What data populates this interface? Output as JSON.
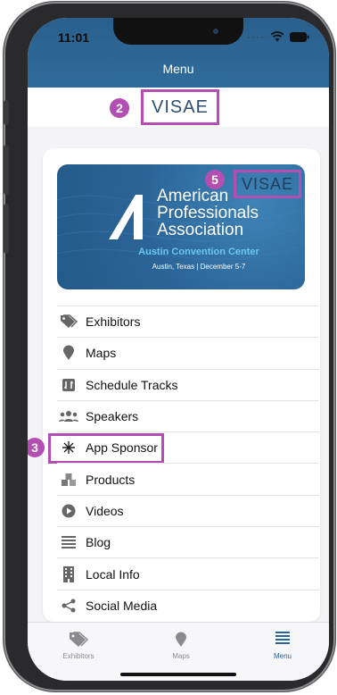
{
  "status_bar": {
    "time": "11:01"
  },
  "header": {
    "title": "Menu"
  },
  "brand": {
    "logo_text": "VISAE",
    "badge_number": "2"
  },
  "banner": {
    "org_line1": "American",
    "org_line2": "Professionals",
    "org_line3": "Association",
    "venue": "Austin Convention Center",
    "date": "Austin, Texas  |  December 5-7",
    "sponsor_logo_text": "VISAE",
    "badge_number": "5"
  },
  "menu": {
    "items": [
      {
        "label": "Exhibitors",
        "icon": "tag-icon"
      },
      {
        "label": "Maps",
        "icon": "map-pin-icon"
      },
      {
        "label": "Schedule Tracks",
        "icon": "schedule-tracks-icon"
      },
      {
        "label": "Speakers",
        "icon": "speakers-icon"
      },
      {
        "label": "App Sponsor",
        "icon": "sparkle-icon",
        "badge_number": "3"
      },
      {
        "label": "Products",
        "icon": "boxes-icon"
      },
      {
        "label": "Videos",
        "icon": "play-icon"
      },
      {
        "label": "Blog",
        "icon": "list-icon"
      },
      {
        "label": "Local Info",
        "icon": "building-icon"
      },
      {
        "label": "Social Media",
        "icon": "share-icon"
      }
    ]
  },
  "tabbar": {
    "tabs": [
      {
        "label": "Exhibitors",
        "icon": "tag-icon",
        "active": false
      },
      {
        "label": "Maps",
        "icon": "map-pin-icon",
        "active": false
      },
      {
        "label": "Menu",
        "icon": "hamburger-menu-icon",
        "active": true
      }
    ]
  },
  "colors": {
    "header_blue": "#2f6c9c",
    "highlight_purple": "#b34fb3",
    "banner_blue": "#2a6396",
    "venue_cyan": "#6cc6ef"
  }
}
